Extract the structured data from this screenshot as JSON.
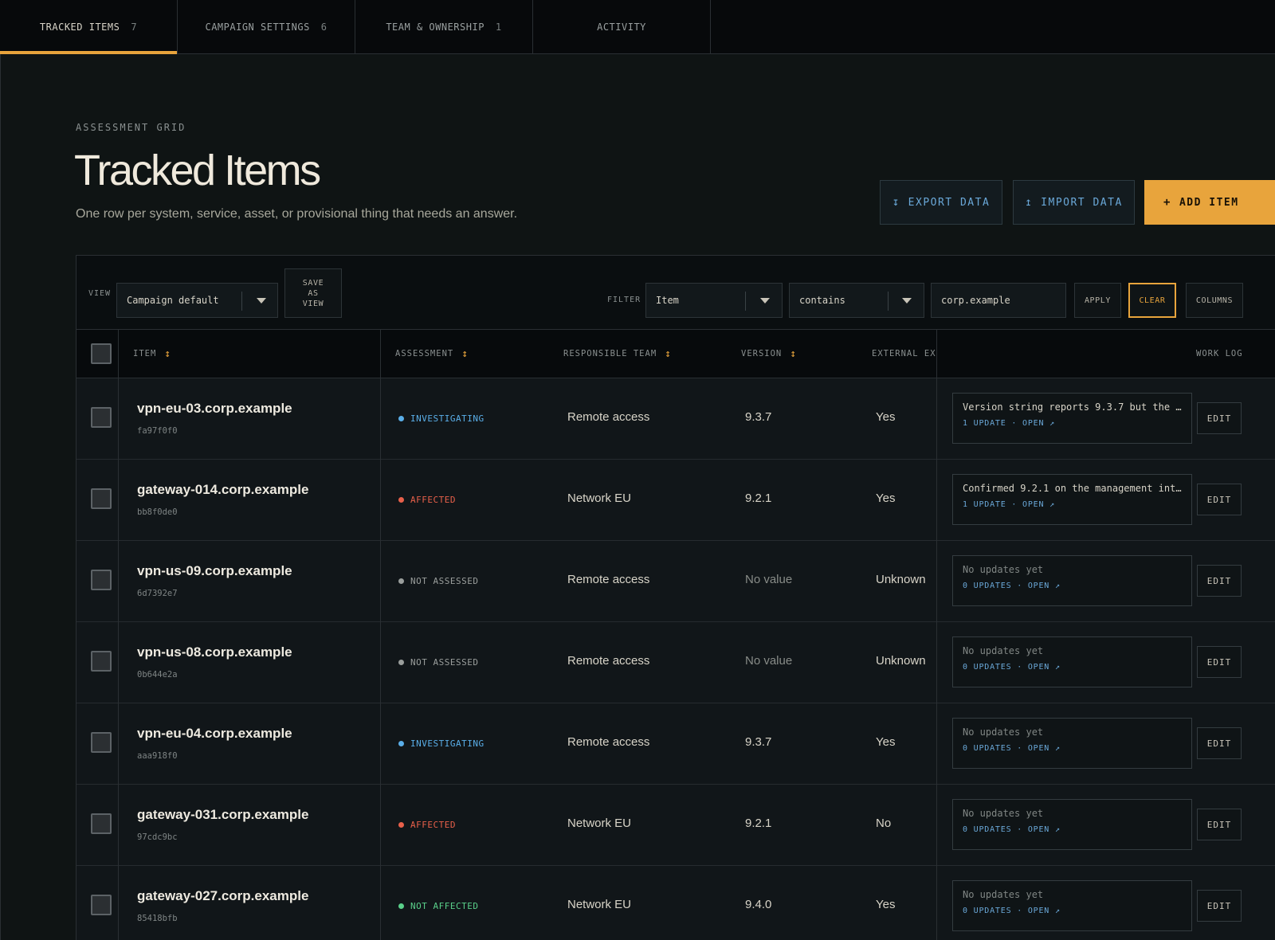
{
  "tabs": [
    {
      "label": "TRACKED ITEMS",
      "count": "7"
    },
    {
      "label": "CAMPAIGN SETTINGS",
      "count": "6"
    },
    {
      "label": "TEAM & OWNERSHIP",
      "count": "1"
    },
    {
      "label": "ACTIVITY",
      "count": ""
    }
  ],
  "header": {
    "eyebrow": "ASSESSMENT GRID",
    "title": "Tracked Items",
    "subtitle": "One row per system, service, asset, or provisional thing that needs an answer.",
    "export_label": "EXPORT DATA",
    "import_label": "IMPORT DATA",
    "add_label": "ADD ITEM"
  },
  "toolbar": {
    "view_label": "VIEW",
    "view_value": "Campaign default",
    "save_view_label": [
      "SAVE",
      "AS",
      "VIEW"
    ],
    "filter_label": "FILTER",
    "filter_field": "Item",
    "filter_operator": "contains",
    "filter_value": "corp.example",
    "apply_label": "APPLY",
    "clear_label": "CLEAR",
    "columns_label": "COLUMNS"
  },
  "columns": {
    "item": "ITEM",
    "assessment": "ASSESSMENT",
    "team": "RESPONSIBLE TEAM",
    "version": "VERSION",
    "external": "EXTERNAL EXP",
    "worklog": "WORK LOG"
  },
  "colors": {
    "accent": "#e8a43c",
    "investigating": "#5aaee8",
    "affected": "#e8604a",
    "not_assessed": "#9a9e9c",
    "not_affected": "#5ad08a"
  },
  "rows": [
    {
      "name": "vpn-eu-03.corp.example",
      "id": "fa97f0f0",
      "status": "INVESTIGATING",
      "status_key": "investigating",
      "team": "Remote access",
      "version": "9.3.7",
      "version_empty": false,
      "external": "Yes",
      "note": "Version string reports 9.3.7 but the b...",
      "note_empty": false,
      "updates": "1 UPDATE · OPEN ↗",
      "edit": "EDIT"
    },
    {
      "name": "gateway-014.corp.example",
      "id": "bb8f0de0",
      "status": "AFFECTED",
      "status_key": "affected",
      "team": "Network EU",
      "version": "9.2.1",
      "version_empty": false,
      "external": "Yes",
      "note": "Confirmed 9.2.1 on the management inte...",
      "note_empty": false,
      "updates": "1 UPDATE · OPEN ↗",
      "edit": "EDIT"
    },
    {
      "name": "vpn-us-09.corp.example",
      "id": "6d7392e7",
      "status": "NOT ASSESSED",
      "status_key": "not_assessed",
      "team": "Remote access",
      "version": "No value",
      "version_empty": true,
      "external": "Unknown",
      "note": "No updates yet",
      "note_empty": true,
      "updates": "0 UPDATES · OPEN ↗",
      "edit": "EDIT"
    },
    {
      "name": "vpn-us-08.corp.example",
      "id": "0b644e2a",
      "status": "NOT ASSESSED",
      "status_key": "not_assessed",
      "team": "Remote access",
      "version": "No value",
      "version_empty": true,
      "external": "Unknown",
      "note": "No updates yet",
      "note_empty": true,
      "updates": "0 UPDATES · OPEN ↗",
      "edit": "EDIT"
    },
    {
      "name": "vpn-eu-04.corp.example",
      "id": "aaa918f0",
      "status": "INVESTIGATING",
      "status_key": "investigating",
      "team": "Remote access",
      "version": "9.3.7",
      "version_empty": false,
      "external": "Yes",
      "note": "No updates yet",
      "note_empty": true,
      "updates": "0 UPDATES · OPEN ↗",
      "edit": "EDIT"
    },
    {
      "name": "gateway-031.corp.example",
      "id": "97cdc9bc",
      "status": "AFFECTED",
      "status_key": "affected",
      "team": "Network EU",
      "version": "9.2.1",
      "version_empty": false,
      "external": "No",
      "note": "No updates yet",
      "note_empty": true,
      "updates": "0 UPDATES · OPEN ↗",
      "edit": "EDIT"
    },
    {
      "name": "gateway-027.corp.example",
      "id": "85418bfb",
      "status": "NOT AFFECTED",
      "status_key": "not_affected",
      "team": "Network EU",
      "version": "9.4.0",
      "version_empty": false,
      "external": "Yes",
      "note": "No updates yet",
      "note_empty": true,
      "updates": "0 UPDATES · OPEN ↗",
      "edit": "EDIT"
    }
  ]
}
